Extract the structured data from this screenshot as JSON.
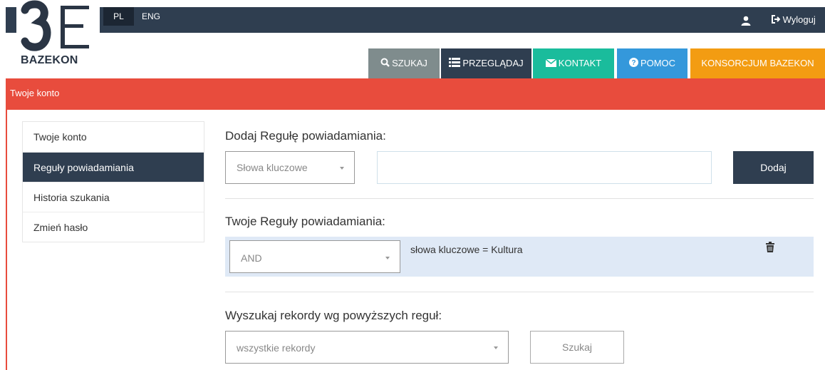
{
  "header": {
    "lang_pl": "PL",
    "lang_eng": "ENG",
    "logout_label": "Wyloguj",
    "logo_text": "BAZEKON"
  },
  "nav": [
    {
      "label": "SZUKAJ",
      "color": "#7f8c8d",
      "icon": "search-icon"
    },
    {
      "label": "PRZEGLĄDAJ",
      "color": "#2f3e50",
      "icon": "list-icon"
    },
    {
      "label": "KONTAKT",
      "color": "#1abc9c",
      "icon": "envelope-icon"
    },
    {
      "label": "POMOC",
      "color": "#3498db",
      "icon": "help-icon"
    },
    {
      "label": "KONSORCJUM BAZEKON",
      "color": "#f39c12",
      "icon": ""
    }
  ],
  "section_title": "Twoje konto",
  "sidebar": {
    "items": [
      {
        "label": "Twoje konto"
      },
      {
        "label": "Reguły powiadamiania"
      },
      {
        "label": "Historia szukania"
      },
      {
        "label": "Zmień hasło"
      }
    ],
    "active_index": 1
  },
  "add_rule": {
    "title": "Dodaj Regułę powiadamiania:",
    "field_select": "Słowa kluczowe",
    "input_value": "",
    "add_button": "Dodaj"
  },
  "your_rules": {
    "title": "Twoje Reguły powiadamiania:",
    "rules": [
      {
        "operator": "AND",
        "text": "słowa kluczowe = Kultura"
      }
    ]
  },
  "search": {
    "title": "Wyszukaj rekordy wg powyższych reguł:",
    "scope_select": "wszystkie rekordy",
    "search_button": "Szukaj"
  },
  "colors": {
    "topbar": "#2f3e50",
    "accent_red": "#e84c3d",
    "rule_bg": "#dfe9f6"
  }
}
